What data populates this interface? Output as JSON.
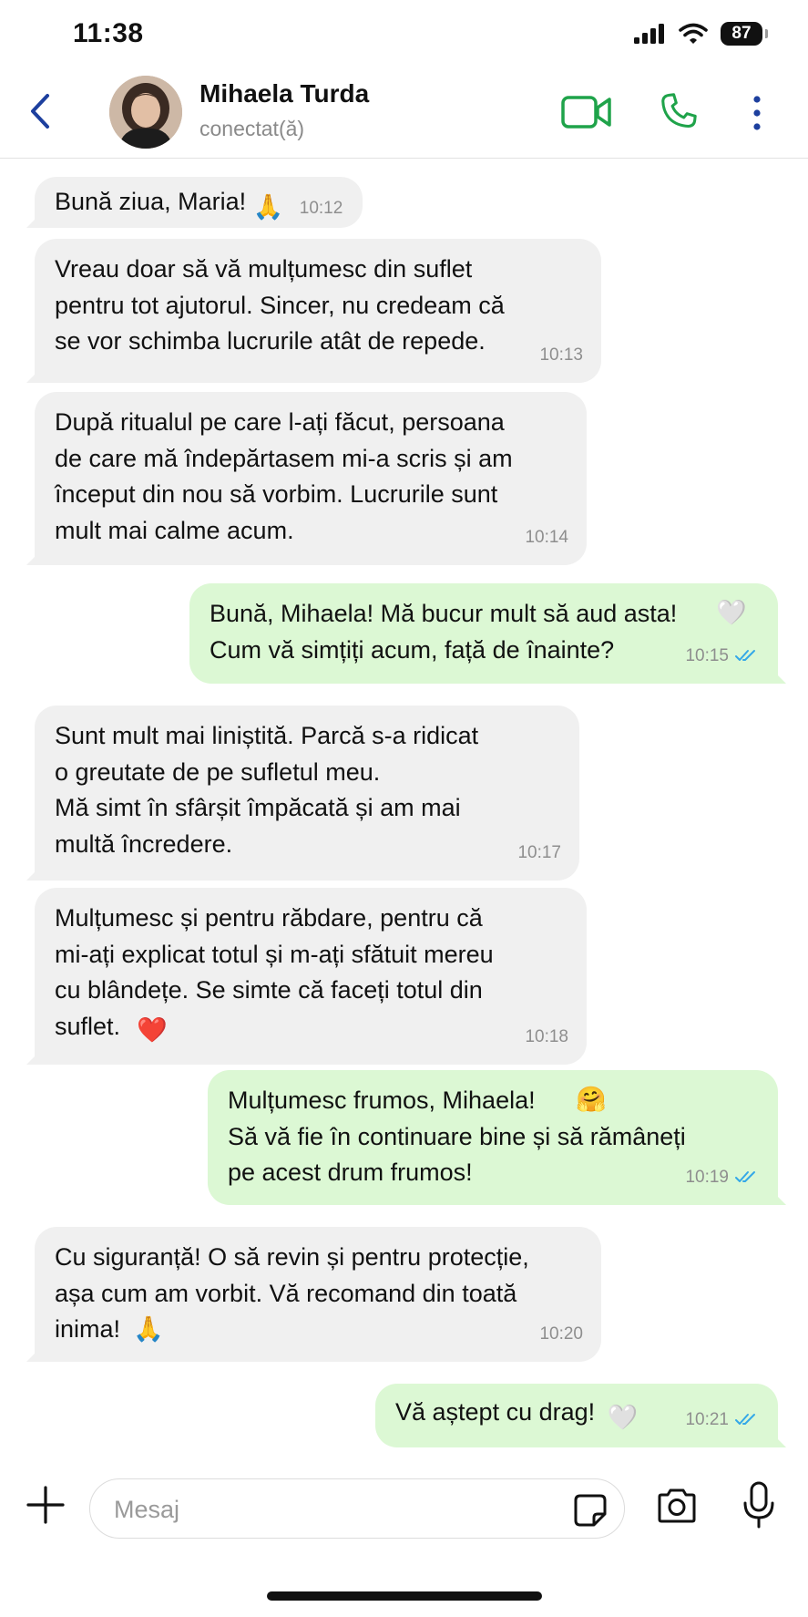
{
  "status_bar": {
    "time": "11:38",
    "battery": "87"
  },
  "header": {
    "contact_name": "Mihaela Turda",
    "contact_status": "conectat(ă)"
  },
  "messages": [
    {
      "direction": "in",
      "text": "Bună ziua, Maria!",
      "emoji": "🙏",
      "time": "10:12"
    },
    {
      "direction": "in",
      "text": "Vreau doar să vă mulțumesc din suflet\npentru tot ajutorul. Sincer, nu credeam că\nse vor schimba lucrurile atât de repede.",
      "time": "10:13"
    },
    {
      "direction": "in",
      "text": "După ritualul pe care l-ați făcut, persoana\nde care mă îndepărtasem mi-a scris și am\nînceput din nou să vorbim. Lucrurile sunt\nmult mai calme acum.",
      "time": "10:14"
    },
    {
      "direction": "out",
      "text": "Bună, Mihaela! Mă bucur mult să aud asta!\nCum vă simțiți acum, față de înainte?",
      "emoji": "🤍",
      "time": "10:15",
      "status": "read"
    },
    {
      "direction": "in",
      "text": "Sunt mult mai liniștită. Parcă s-a ridicat\no greutate de pe sufletul meu.\nMă simt în sfârșit împăcată și am mai\nmultă încredere.",
      "time": "10:17"
    },
    {
      "direction": "in",
      "text": "Mulțumesc și pentru răbdare, pentru că\nmi-ați explicat totul și m-ați sfătuit mereu\ncu blândețe. Se simte că faceți totul din\nsuflet.",
      "emoji": "❤️",
      "time": "10:18"
    },
    {
      "direction": "out",
      "text": "Mulțumesc frumos, Mihaela!\nSă vă fie în continuare bine și să rămâneți\npe acest drum frumos!",
      "emoji": "🤗",
      "time": "10:19",
      "status": "read"
    },
    {
      "direction": "in",
      "text": "Cu siguranță! O să revin și pentru protecție,\nașa cum am vorbit. Vă recomand din toată\ninima!",
      "emoji": "🙏",
      "time": "10:20"
    },
    {
      "direction": "out",
      "text": "Vă aștept cu drag!",
      "emoji": "🤍",
      "time": "10:21",
      "status": "read"
    }
  ],
  "composer": {
    "placeholder": "Mesaj"
  },
  "colors": {
    "accent_green": "#1fa34a",
    "header_blue": "#1d3f9e",
    "incoming_bubble": "#f0f0f0",
    "outgoing_bubble": "#dcf8d4",
    "read_tick": "#34a8e8"
  },
  "icons": {
    "back": "chevron-left-icon",
    "video": "video-call-icon",
    "phone": "phone-icon",
    "more": "more-vertical-icon",
    "plus": "plus-icon",
    "sticker": "sticker-icon",
    "camera": "camera-icon",
    "mic": "microphone-icon",
    "read": "double-check-icon"
  }
}
